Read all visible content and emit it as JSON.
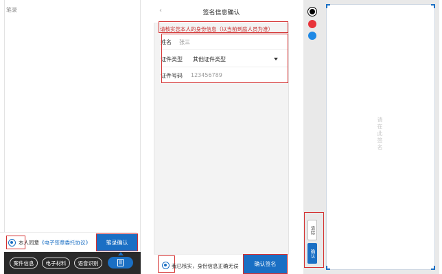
{
  "panel1": {
    "title": "笔录",
    "agree_prefix": "本人同意",
    "agreement_link": "《电子签章委托协议》",
    "confirm_button": "笔录确认",
    "toolbar": [
      "案件信息",
      "电子材料",
      "语音识别"
    ],
    "active_tool_icon": "document-icon"
  },
  "panel2": {
    "back_icon": "chevron-left-icon",
    "title": "签名信息确认",
    "notice": "请核实您本人的身份信息（以当前到庭人员为准）",
    "fields": [
      {
        "label": "姓名",
        "value": "张三"
      },
      {
        "label": "证件类型",
        "value": "其他证件类型"
      },
      {
        "label": "证件号码",
        "value": "123456789"
      }
    ],
    "agree_text": "我已核实，身份信息正确无误",
    "confirm_button": "确认签名"
  },
  "panel3": {
    "colors": [
      "#000000",
      "#e8343a",
      "#1e88e5"
    ],
    "canvas_placeholder": "请在此签名",
    "clear_button": "清除",
    "confirm_button": "确认"
  }
}
